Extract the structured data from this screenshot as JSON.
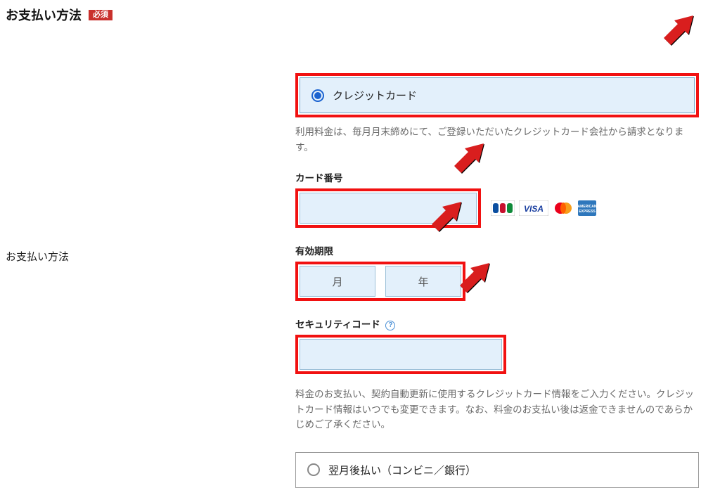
{
  "header": {
    "title": "お支払い方法",
    "required": "必須"
  },
  "left": {
    "label": "お支払い方法"
  },
  "credit_card_option": {
    "label": "クレジットカード",
    "description": "利用料金は、毎月月末締めにて、ご登録いただいたクレジットカード会社から請求となります。"
  },
  "card_number": {
    "label": "カード番号",
    "value": ""
  },
  "expiry": {
    "label": "有効期限",
    "month_label": "月",
    "year_label": "年"
  },
  "security_code": {
    "label": "セキュリティコード",
    "value": ""
  },
  "credit_card_notice": "料金のお支払い、契約自動更新に使用するクレジットカード情報をご入力ください。クレジットカード情報はいつでも変更できます。なお、料金のお支払い後は返金できませんのであらかじめご了承ください。",
  "deferred_option": {
    "label": "翌月後払い（コンビニ／銀行）"
  }
}
